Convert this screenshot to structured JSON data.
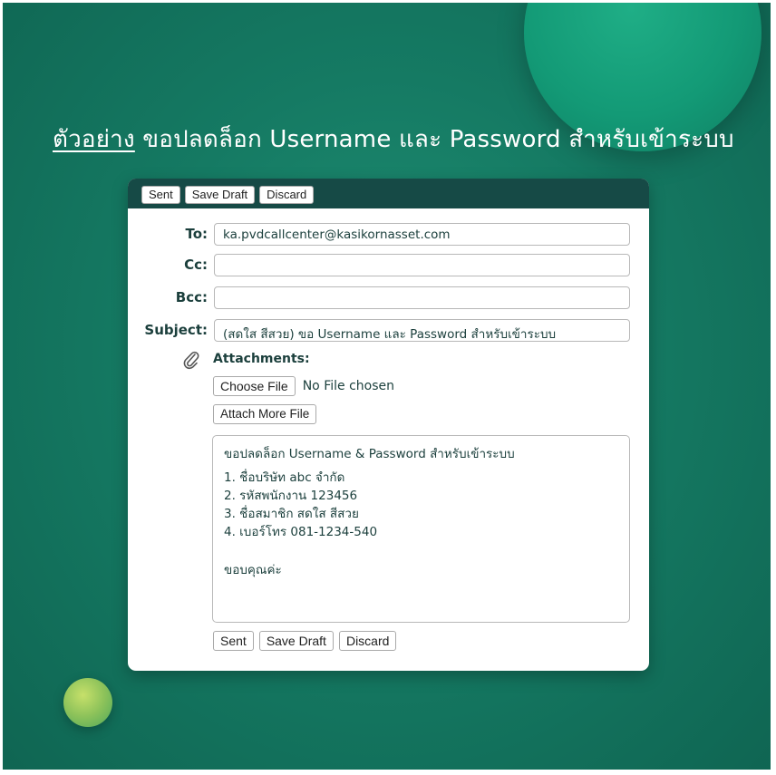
{
  "headline": {
    "prefix": "ตัวอย่าง",
    "rest": " ขอปลดล็อก Username และ Password สำหรับเข้าระบบ"
  },
  "toolbar": {
    "sent_label": "Sent",
    "save_draft_label": "Save Draft",
    "discard_label": "Discard"
  },
  "fields": {
    "to_label": "To:",
    "to_value": "ka.pvdcallcenter@kasikornasset.com",
    "cc_label": "Cc:",
    "cc_value": "",
    "bcc_label": "Bcc:",
    "bcc_value": "",
    "subject_label": "Subject:",
    "subject_value": "(สดใส สีสวย) ขอ Username และ Password สำหรับเข้าระบบ"
  },
  "attachments": {
    "label": "Attachments:",
    "choose_file_label": "Choose File",
    "no_file_text": "No File chosen",
    "attach_more_label": "Attach More File"
  },
  "message": {
    "heading": "ขอปลดล็อก Username & Password สำหรับเข้าระบบ",
    "items": [
      "1. ชื่อบริษัท abc จำกัด",
      "2. รหัสพนักงาน 123456",
      "3. ชื่อสมาชิก สดใส สีสวย",
      "4. เบอร์โทร 081-1234-540"
    ],
    "closing": "ขอบคุณค่ะ"
  },
  "bottom_bar": {
    "sent_label": "Sent",
    "save_draft_label": "Save Draft",
    "discard_label": "Discard"
  },
  "colors": {
    "background": "#157a63",
    "toolbar": "#164a46",
    "text": "#1b3f3c"
  },
  "icons": {
    "attachment": "paperclip-icon"
  }
}
